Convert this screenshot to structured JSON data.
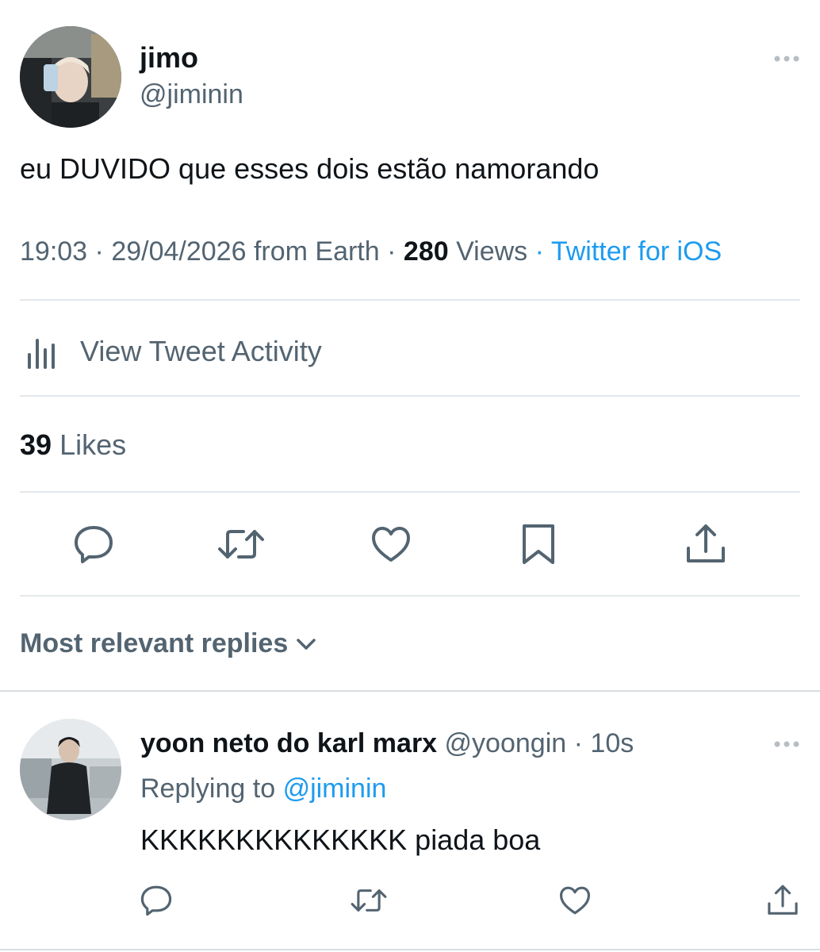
{
  "tweet": {
    "author": {
      "name": "jimo",
      "handle": "@jiminin"
    },
    "text": "eu DUVIDO que esses dois estão namorando",
    "time": "19:03",
    "date": "29/04/2026",
    "location": "from Earth",
    "views_count": "280",
    "views_label": "Views",
    "source": "Twitter for iOS",
    "separator": "·",
    "activity_label": "View Tweet Activity",
    "likes_count": "39",
    "likes_label": "Likes"
  },
  "actions": [
    "reply-icon",
    "retweet-icon",
    "like-icon",
    "bookmark-icon",
    "share-icon"
  ],
  "replies": {
    "sort_label": "Most relevant replies",
    "items": [
      {
        "name": "yoon neto do karl marx",
        "handle": "@yoongin",
        "time": "10s",
        "replying_prefix": "Replying to",
        "replying_to": "@jiminin",
        "text": "KKKKKKKKKKKKKK piada boa"
      }
    ]
  },
  "colors": {
    "text_primary": "#0f1419",
    "text_secondary": "#536471",
    "link": "#1d9bf0",
    "divider": "#e4e8eb",
    "background": "#ffffff"
  }
}
